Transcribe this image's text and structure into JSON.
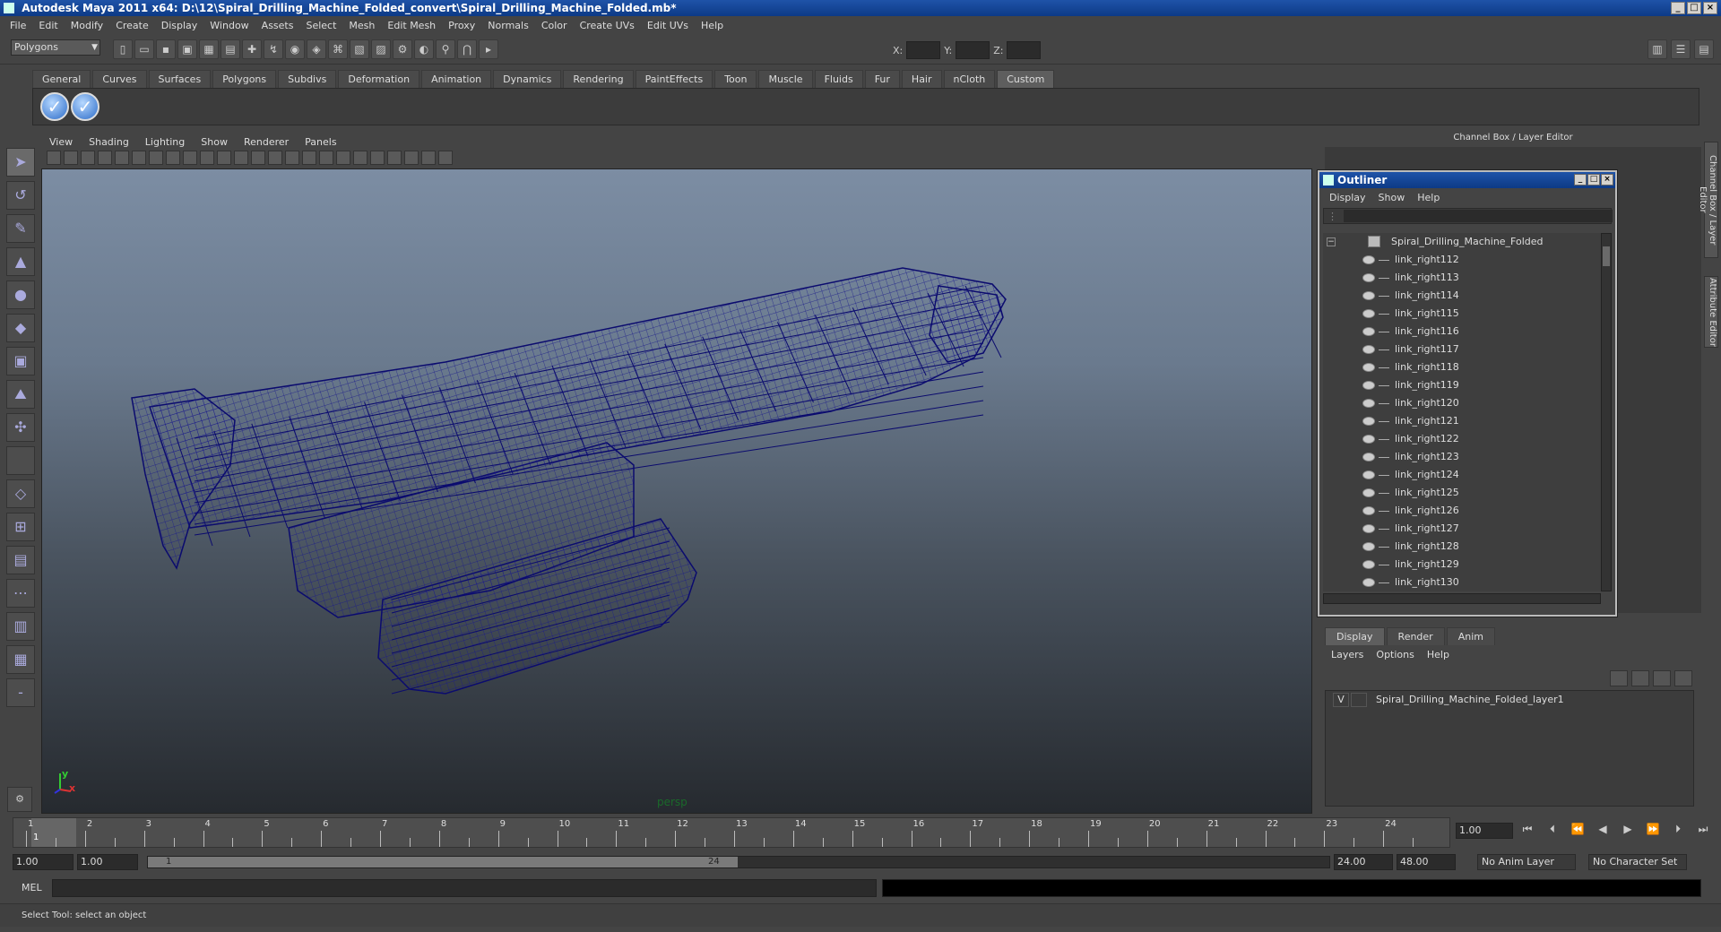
{
  "window": {
    "title": "Autodesk Maya 2011 x64: D:\\12\\Spiral_Drilling_Machine_Folded_convert\\Spiral_Drilling_Machine_Folded.mb*"
  },
  "menubar": [
    "File",
    "Edit",
    "Modify",
    "Create",
    "Display",
    "Window",
    "Assets",
    "Select",
    "Mesh",
    "Edit Mesh",
    "Proxy",
    "Normals",
    "Color",
    "Create UVs",
    "Edit UVs",
    "Help"
  ],
  "statusline": {
    "mode": "Polygons",
    "x_label": "X:",
    "y_label": "Y:",
    "z_label": "Z:"
  },
  "shelf": {
    "tabs": [
      "General",
      "Curves",
      "Surfaces",
      "Polygons",
      "Subdivs",
      "Deformation",
      "Animation",
      "Dynamics",
      "Rendering",
      "PaintEffects",
      "Toon",
      "Muscle",
      "Fluids",
      "Fur",
      "Hair",
      "nCloth",
      "Custom"
    ],
    "active_tab": "Custom"
  },
  "viewport": {
    "menus": [
      "View",
      "Shading",
      "Lighting",
      "Show",
      "Renderer",
      "Panels"
    ],
    "camera": "persp",
    "axis_y": "y",
    "axis_x": "x",
    "wire_color": "#0b0b6e"
  },
  "channel_box": {
    "title": "Channel Box / Layer Editor",
    "side_tab_1": "Channel Box / Layer Editor",
    "side_tab_2": "Attribute Editor"
  },
  "outliner": {
    "title": "Outliner",
    "menus": [
      "Display",
      "Show",
      "Help"
    ],
    "root": "Spiral_Drilling_Machine_Folded",
    "items": [
      "link_right112",
      "link_right113",
      "link_right114",
      "link_right115",
      "link_right116",
      "link_right117",
      "link_right118",
      "link_right119",
      "link_right120",
      "link_right121",
      "link_right122",
      "link_right123",
      "link_right124",
      "link_right125",
      "link_right126",
      "link_right127",
      "link_right128",
      "link_right129",
      "link_right130"
    ]
  },
  "layer_editor": {
    "tabs": [
      "Display",
      "Render",
      "Anim"
    ],
    "active_tab": "Display",
    "menus": [
      "Layers",
      "Options",
      "Help"
    ],
    "layers": [
      {
        "visible": "V",
        "name": "Spiral_Drilling_Machine_Folded_layer1"
      }
    ]
  },
  "timeline": {
    "ticks": [
      "1",
      "2",
      "3",
      "4",
      "5",
      "6",
      "7",
      "8",
      "9",
      "10",
      "11",
      "12",
      "13",
      "14",
      "15",
      "16",
      "17",
      "18",
      "19",
      "20",
      "21",
      "22",
      "23",
      "24"
    ],
    "current_frame": "1",
    "current_time": "1.00"
  },
  "range": {
    "start_time": "1.00",
    "playback_start": "1.00",
    "range_start_label": "1",
    "range_end_label": "24",
    "playback_end": "24.00",
    "end_time": "48.00",
    "anim_layer": "No Anim Layer",
    "character_set": "No Character Set"
  },
  "command_line": {
    "label": "MEL"
  },
  "help_line": {
    "text": "Select Tool: select an object"
  }
}
